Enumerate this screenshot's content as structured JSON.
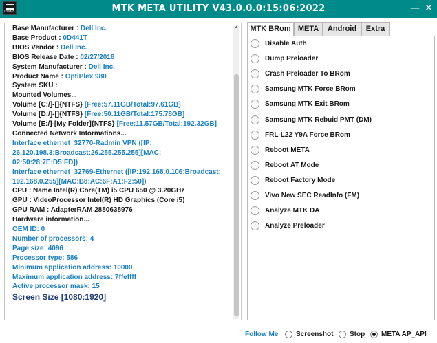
{
  "window": {
    "title": "MTK META UTILITY V43.0.0.0:15:06:2022",
    "logo_text": "iHaKz",
    "minimize_glyph": "—",
    "close_glyph": "✕"
  },
  "info": {
    "lines": [
      {
        "label": "Base Manufacturer : ",
        "value": "Dell Inc."
      },
      {
        "label": "Base Product : ",
        "value": "0D441T"
      },
      {
        "label": "BIOS Vendor : ",
        "value": "Dell Inc."
      },
      {
        "label": "BIOS Release Date : ",
        "value": "02/27/2018"
      },
      {
        "label": "System Manufacturer : ",
        "value": "Dell Inc."
      },
      {
        "label": "Product Name : ",
        "value": "OptiPlex 980"
      },
      {
        "label": "System SKU : ",
        "value": ""
      },
      {
        "label": "Mounted Volumes...",
        "value": ""
      },
      {
        "label": "Volume [C:/]-[]{NTFS} ",
        "value": "[Free:57.11GB/Total:97.61GB]"
      },
      {
        "label": "Volume [D:/]-[]{NTFS} ",
        "value": "[Free:50.11GB/Total:175.78GB]"
      },
      {
        "label": "Volume [E:/]-[My Folder]{NTFS} ",
        "value": "[Free:11.57GB/Total:192.32GB]"
      },
      {
        "label": "Connected Network Informations...",
        "value": ""
      }
    ],
    "network_lines": [
      "Interface ethernet_32770-Radmin VPN ([IP:",
      "26.120.198.3:Broadcast:26.255.255.255][MAC:",
      "02:50:28:7E:D5:FD])",
      "Interface ethernet_32769-Ethernet ([IP:192.168.0.106:Broadcast:",
      "192.168.0.255][MAC:B8:AC:6F:A1:F2:50])"
    ],
    "hw_lines": [
      {
        "label": "CPU  : Name Intel(R) Core(TM) i5 CPU 650 @ 3.20GHz",
        "value": ""
      },
      {
        "label": "GPU  : VideoProcessor Intel(R) HD Graphics (Core i5)",
        "value": ""
      },
      {
        "label": "GPU RAM  : AdapterRAM 2880638976",
        "value": ""
      },
      {
        "label": "Hardware information...",
        "value": ""
      }
    ],
    "detail_lines": [
      "OEM ID: 0",
      "Number of processors: 4",
      "Page size: 4096",
      "Processor type: 586",
      "Minimum application address: 10000",
      "Maximum application address: 7ffeffff",
      "Active processor mask: 15"
    ],
    "screen_size": "Screen Size [1080:1920]"
  },
  "tabs": [
    {
      "label": "MTK BRom",
      "active": true
    },
    {
      "label": "META",
      "active": false
    },
    {
      "label": "Android",
      "active": false
    },
    {
      "label": "Extra",
      "active": false
    }
  ],
  "options": [
    "Disable Auth",
    "Dump Preloader",
    "Crash Preloader To BRom",
    "Samsung MTK Force BRom",
    "Samsung MTK Exit BRom",
    "Samsung MTK Rebuid PMT (DM)",
    "FRL-L22 Y9A Force BRom",
    "Reboot META",
    "Reboot AT Mode",
    "Reboot Factory Mode",
    "Vivo New SEC ReadInfo (FM)",
    "Analyze MTK DA",
    "Analyze Preloader"
  ],
  "bottom": {
    "follow_label": "Follow Me",
    "screenshot_label": "Screenshot",
    "stop_label": "Stop",
    "meta_label": "META AP_API",
    "selected": "META AP_API"
  }
}
